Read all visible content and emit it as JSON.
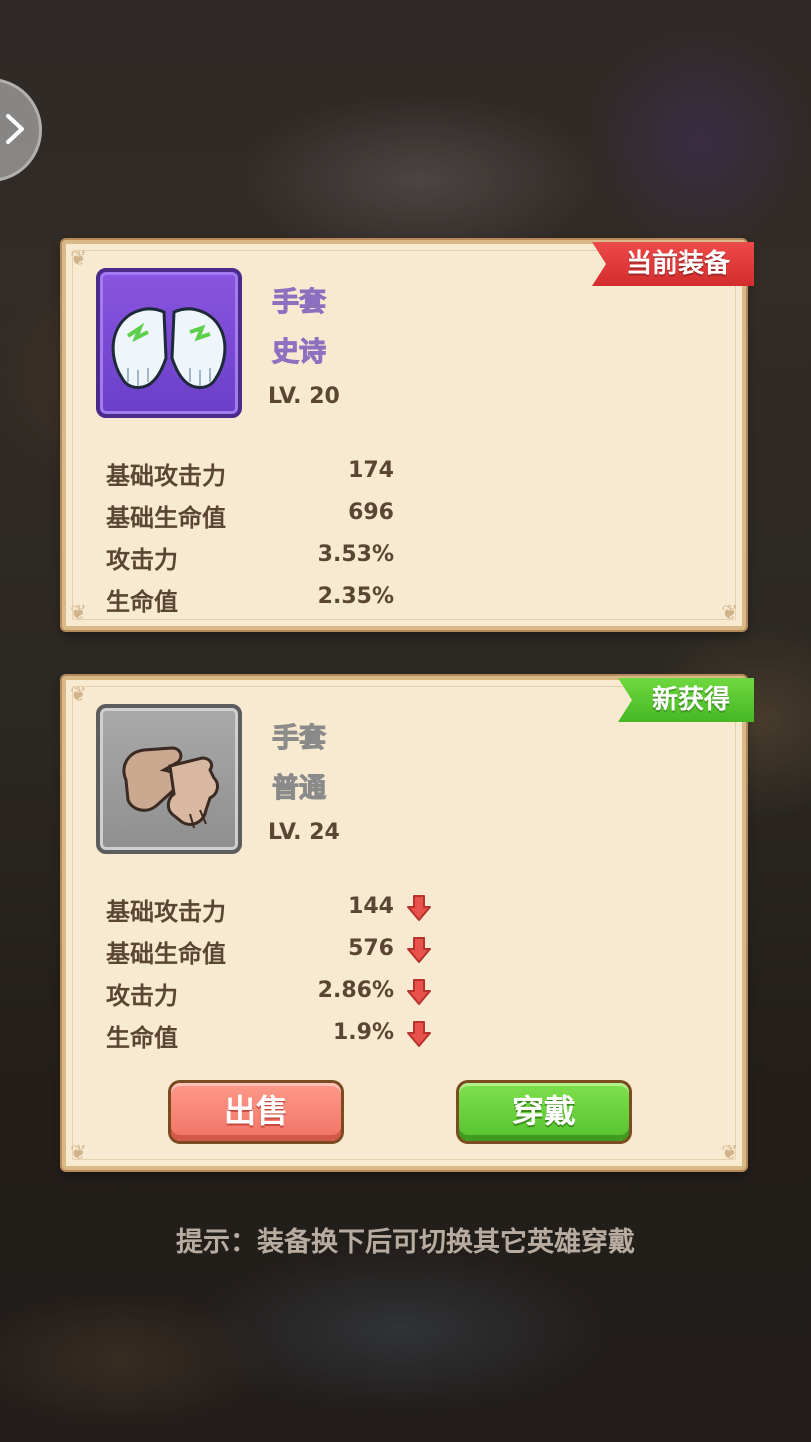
{
  "current": {
    "ribbon": "当前装备",
    "item_name": "手套",
    "rarity": "史诗",
    "level": "LV. 20",
    "icon": "white-glove-icon",
    "stats": [
      {
        "label": "基础攻击力",
        "value": "174"
      },
      {
        "label": "基础生命值",
        "value": "696"
      },
      {
        "label": "攻击力",
        "value": "3.53%"
      },
      {
        "label": "生命值",
        "value": "2.35%"
      }
    ]
  },
  "new_item": {
    "ribbon": "新获得",
    "item_name": "手套",
    "rarity": "普通",
    "level": "LV. 24",
    "icon": "leather-glove-icon",
    "stats": [
      {
        "label": "基础攻击力",
        "value": "144",
        "trend": "down"
      },
      {
        "label": "基础生命值",
        "value": "576",
        "trend": "down"
      },
      {
        "label": "攻击力",
        "value": "2.86%",
        "trend": "down"
      },
      {
        "label": "生命值",
        "value": "1.9%",
        "trend": "down"
      }
    ],
    "sell_label": "出售",
    "equip_label": "穿戴"
  },
  "hint": "提示：装备换下后可切换其它英雄穿戴",
  "colors": {
    "ribbon_current": "#e23a3a",
    "ribbon_new": "#5ccb31",
    "epic": "#7a4bd8",
    "common": "#9a9a9a",
    "stat_down": "#e8524a"
  }
}
